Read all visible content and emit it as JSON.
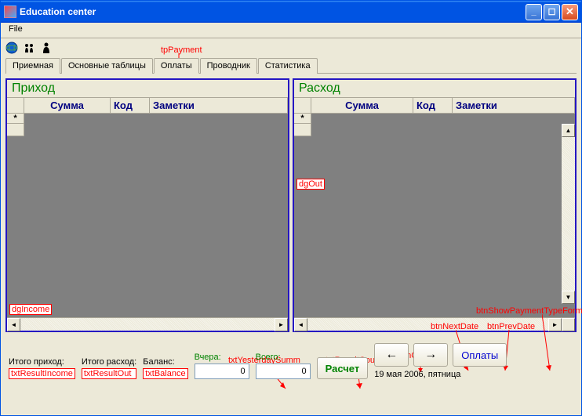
{
  "window": {
    "title": "Education center"
  },
  "menu": {
    "file": "File"
  },
  "tabs": {
    "reception": "Приемная",
    "tables": "Основные таблицы",
    "payments": "Оплаты",
    "explorer": "Проводник",
    "stats": "Статистика"
  },
  "annotations": {
    "tpPayment": "tpPayment",
    "dgOut": "dgOut",
    "dgIncome": "dgIncome",
    "txtYesterdaySumm": "txtYesterdaySumm",
    "txtResultCount": "txtResultCount",
    "btnCalculate": "btnCalculate",
    "btnNextDate": "btnNextDate",
    "btnPrevDate": "btnPrevDate",
    "btnShowPaymentTypeForm": "btnShowPaymentTypeForm",
    "txtResultIncome": "txtResultIncome",
    "txtResultOut": "txtResultOut",
    "txtBalance": "txtBalance"
  },
  "income": {
    "title": "Приход",
    "cols": {
      "sum": "Сумма",
      "code": "Код",
      "notes": "Заметки"
    },
    "newrow": "*"
  },
  "expense": {
    "title": "Расход",
    "cols": {
      "sum": "Сумма",
      "code": "Код",
      "notes": "Заметки"
    },
    "newrow": "*"
  },
  "footer": {
    "totalIncomeLabel": "Итого приход:",
    "totalExpenseLabel": "Итого расход:",
    "balanceLabel": "Баланс:",
    "yesterdayLabel": "Вчера:",
    "yesterdayValue": "0",
    "totalLabel": "Всего:",
    "totalValue": "0",
    "calcLabel": "Расчет",
    "prevArrow": "←",
    "nextArrow": "→",
    "paymentsBtn": "Оплаты",
    "dateText": "19 мая 2006, пятница"
  }
}
